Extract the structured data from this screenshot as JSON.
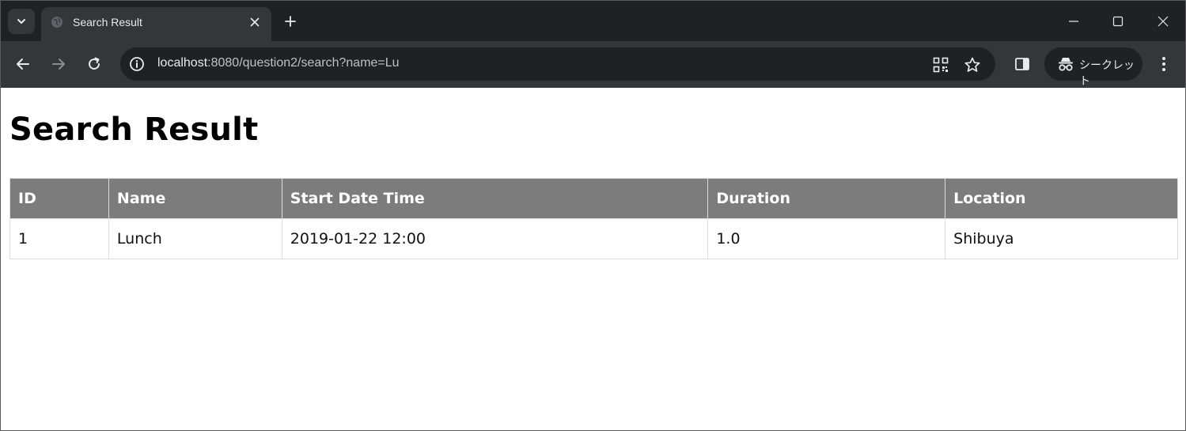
{
  "browser": {
    "tab": {
      "title": "Search Result"
    },
    "address_bar": {
      "url_host": "localhost",
      "url_rest": ":8080/question2/search?name=Lu"
    },
    "profile": {
      "label": "シークレット"
    }
  },
  "page": {
    "heading": "Search Result",
    "table": {
      "headers": [
        "ID",
        "Name",
        "Start Date Time",
        "Duration",
        "Location"
      ],
      "rows": [
        [
          "1",
          "Lunch",
          "2019-01-22 12:00",
          "1.0",
          "Shibuya"
        ]
      ]
    }
  },
  "colors": {
    "header_bg": "#7c7c7c",
    "frame_dark": "#202124",
    "toolbar": "#35363a"
  }
}
